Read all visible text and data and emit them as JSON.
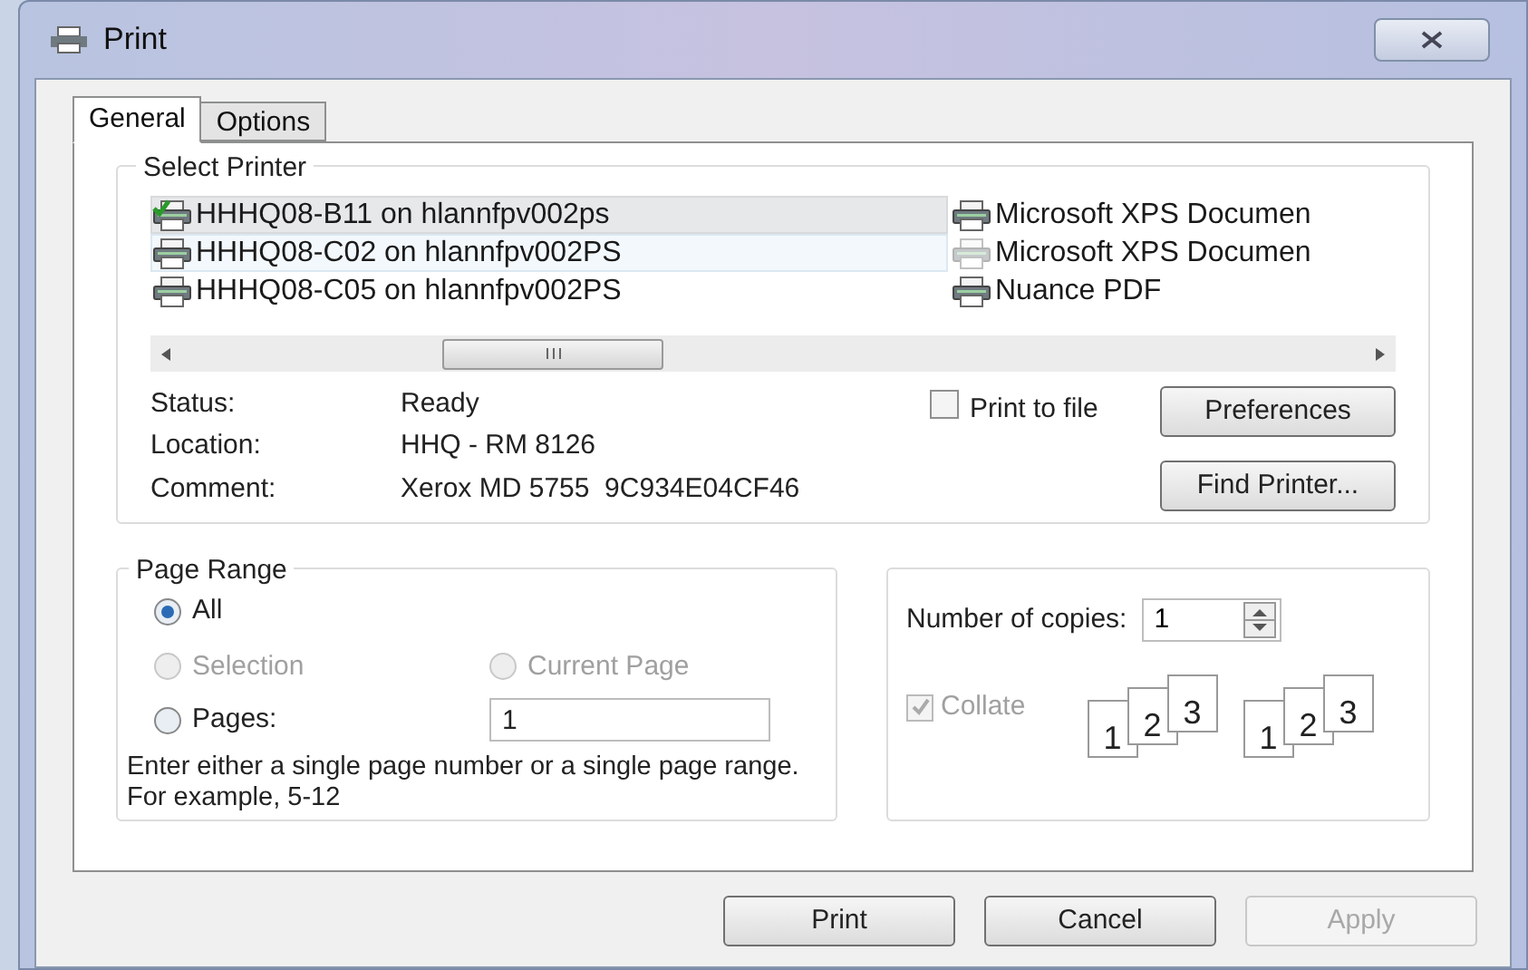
{
  "window": {
    "title": "Print"
  },
  "tabs": [
    {
      "label": "General",
      "selected": true
    },
    {
      "label": "Options",
      "selected": false
    }
  ],
  "select_printer": {
    "title": "Select Printer",
    "printers": [
      {
        "name": "HHHQ08-B11 on hlannfpv002ps",
        "selected": true,
        "hovered": false,
        "default": true
      },
      {
        "name": "HHHQ08-C02 on hlannfpv002PS",
        "selected": false,
        "hovered": true,
        "default": false
      },
      {
        "name": "HHHQ08-C05 on hlannfpv002PS",
        "selected": false,
        "hovered": false,
        "default": false
      },
      {
        "name": "Microsoft XPS Documen",
        "selected": false,
        "hovered": false,
        "default": false
      },
      {
        "name": "Microsoft XPS Documen",
        "selected": false,
        "hovered": false,
        "default": false
      },
      {
        "name": "Nuance PDF",
        "selected": false,
        "hovered": false,
        "default": false
      }
    ],
    "info": [
      {
        "label": "Status:",
        "value": "Ready"
      },
      {
        "label": "Location:",
        "value": "HHQ - RM 8126"
      },
      {
        "label": "Comment:",
        "value": "Xerox MD 5755  9C934E04CF46"
      }
    ],
    "print_to_file": {
      "label": "Print to file",
      "checked": false
    },
    "preferences_button": "Preferences",
    "find_printer_button": "Find Printer..."
  },
  "page_range": {
    "title": "Page Range",
    "options": [
      {
        "label": "All",
        "selected": true,
        "disabled": false
      },
      {
        "label": "Selection",
        "selected": false,
        "disabled": true
      },
      {
        "label": "Current Page",
        "selected": false,
        "disabled": true
      },
      {
        "label": "Pages:",
        "selected": false,
        "disabled": false
      }
    ],
    "pages_value": "1",
    "hint": "Enter either a single page number or a single page range.  For example, 5-12"
  },
  "copies": {
    "label": "Number of copies:",
    "value": "1",
    "collate": {
      "label": "Collate",
      "checked": true,
      "disabled": true
    },
    "collate_pages": [
      "1",
      "2",
      "3",
      "1",
      "2",
      "3"
    ]
  },
  "buttons": [
    {
      "label": "Print",
      "disabled": false
    },
    {
      "label": "Cancel",
      "disabled": false
    },
    {
      "label": "Apply",
      "disabled": true
    }
  ]
}
